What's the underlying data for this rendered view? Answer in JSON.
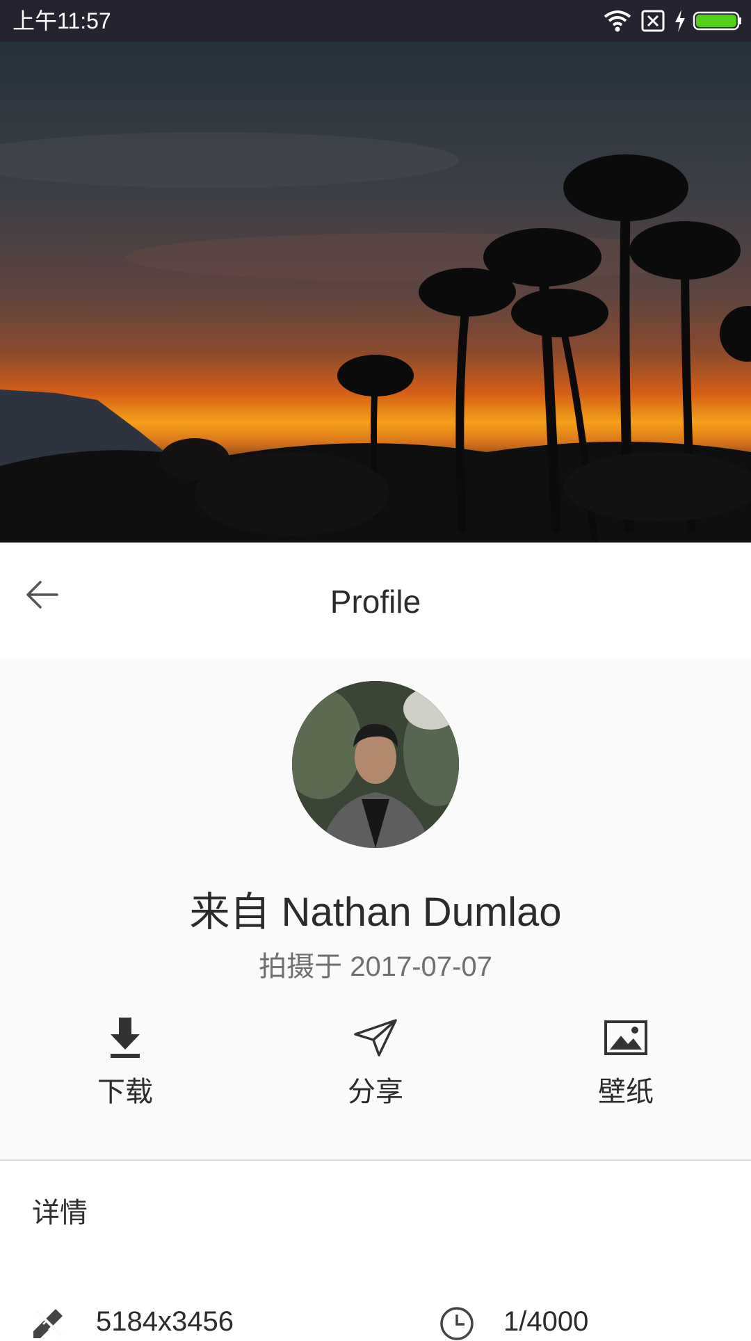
{
  "status_bar": {
    "time": "上午11:57",
    "icons": [
      "wifi-icon",
      "no-sim-icon",
      "charging-bolt-icon",
      "battery-icon"
    ],
    "battery_color": "#52d017"
  },
  "hero": {
    "image": "palm-trees-sunset-photo"
  },
  "toolbar": {
    "title": "Profile",
    "back_icon": "arrow-left-icon"
  },
  "profile": {
    "avatar": "author-avatar-photo",
    "author": "来自 Nathan Dumlao",
    "shot_date": "拍摄于 2017-07-07"
  },
  "actions": [
    {
      "icon": "download-icon",
      "label": "下载"
    },
    {
      "icon": "paper-plane-icon",
      "label": "分享"
    },
    {
      "icon": "image-icon",
      "label": "壁纸"
    }
  ],
  "details": {
    "title": "详情",
    "items": [
      {
        "icon": "pencil-ruler-icon",
        "value": "5184x3456"
      },
      {
        "icon": "clock-icon",
        "value": "1/4000"
      }
    ]
  },
  "colors": {
    "status_bar_bg": "#25232f",
    "panel_bg": "#fafafa",
    "text_primary": "#2b2b2b",
    "text_secondary": "#6f6f6f"
  }
}
